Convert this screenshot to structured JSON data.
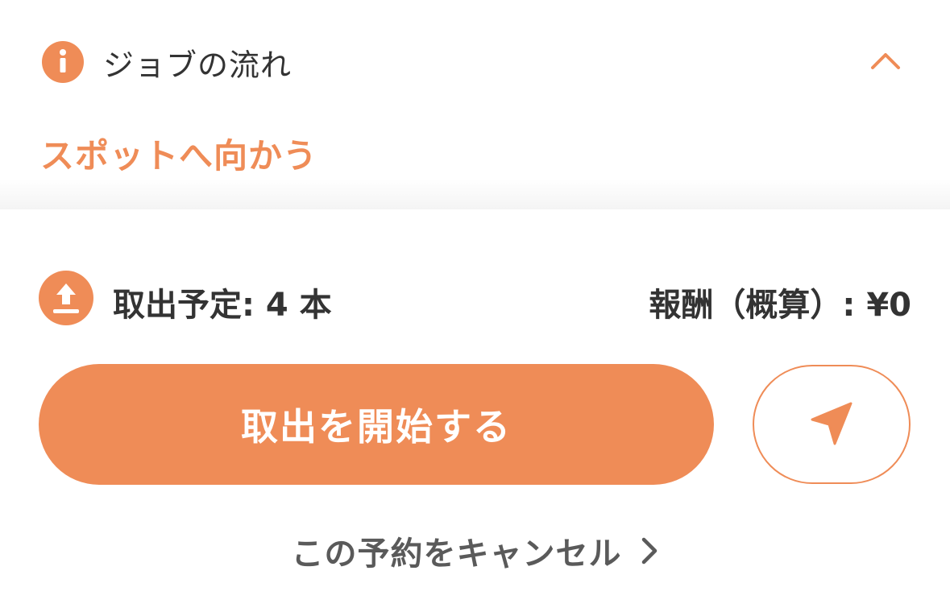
{
  "flow": {
    "title": "ジョブの流れ",
    "step_label": "スポットへ向かう"
  },
  "summary": {
    "pickup_label": "取出予定: 4 本",
    "reward_label": "報酬（概算）: ¥0"
  },
  "actions": {
    "start_label": "取出を開始する",
    "cancel_label": "この予約をキャンセル"
  },
  "icons": {
    "info": "info-icon",
    "collapse": "chevron-up-icon",
    "upload": "upload-icon",
    "navigate": "navigation-arrow-icon",
    "cancel_arrow": "chevron-right-icon"
  },
  "colors": {
    "accent": "#ef8c57",
    "text_primary": "#333333",
    "text_secondary": "#5a5a5a",
    "background": "#ffffff"
  }
}
